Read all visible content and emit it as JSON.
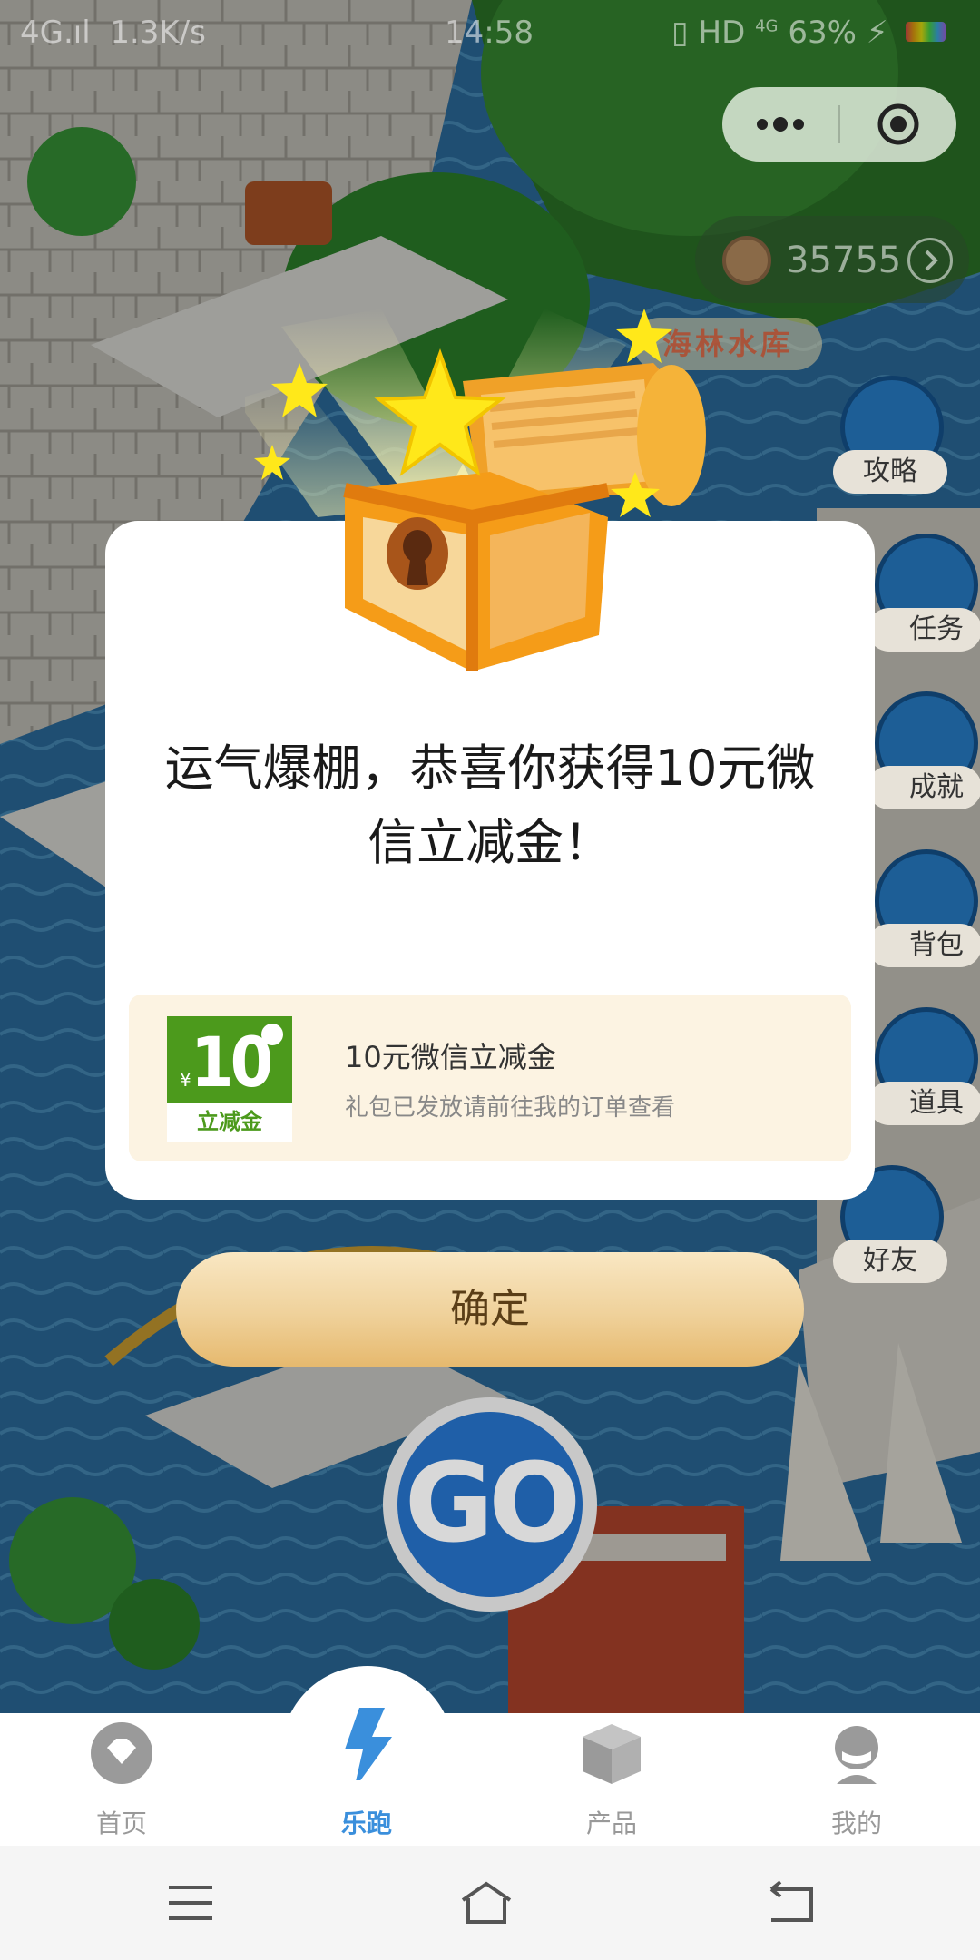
{
  "status_bar": {
    "network": "4G.ıl",
    "speed": "1.3K/s",
    "time": "14:58",
    "indicators": "HD",
    "network_type": "4G",
    "battery": "63%"
  },
  "capsule": {
    "more_icon": "more-dots-icon",
    "close_icon": "target-close-icon"
  },
  "coins": {
    "value": "35755"
  },
  "location": {
    "name": "海林水库"
  },
  "side_menu": {
    "items": [
      {
        "label": "攻略"
      },
      {
        "label": "任务"
      },
      {
        "label": "成就"
      },
      {
        "label": "背包"
      },
      {
        "label": "道具"
      },
      {
        "label": "好友"
      }
    ]
  },
  "go_button": {
    "label": "GO"
  },
  "modal": {
    "title": "运气爆棚，恭喜你获得10元微信立减金！",
    "reward": {
      "voucher_currency": "¥",
      "voucher_amount": "10",
      "voucher_label": "立减金",
      "name": "10元微信立减金",
      "description": "礼包已发放请前往我的订单查看"
    },
    "confirm_label": "确定"
  },
  "tab_bar": {
    "tabs": [
      {
        "label": "首页",
        "icon": "home-icon"
      },
      {
        "label": "乐跑",
        "icon": "lightning-icon"
      },
      {
        "label": "产品",
        "icon": "box-icon"
      },
      {
        "label": "我的",
        "icon": "profile-icon"
      }
    ],
    "active_index": 1
  },
  "system_nav": {
    "menu": "menu-icon",
    "home": "home-key-icon",
    "back": "back-icon"
  },
  "colors": {
    "accent": "#3a8fdc",
    "voucher_green": "#4c9a1c",
    "confirm_gold": "#efd19a"
  }
}
